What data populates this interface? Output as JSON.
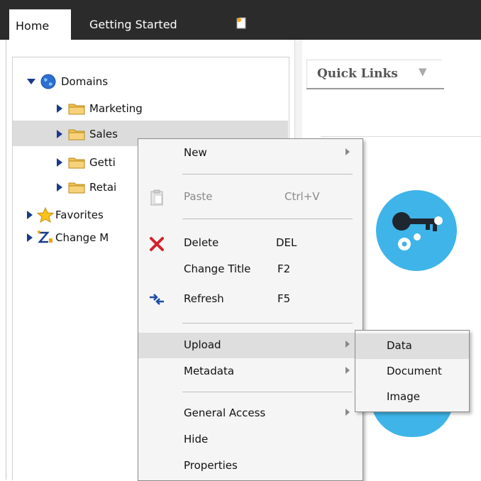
{
  "tabs": {
    "home": "Home",
    "getting_started": "Getting Started"
  },
  "quick_links": {
    "label": "Quick Links"
  },
  "tree": {
    "root": "Domains",
    "children": [
      "Marketing",
      "Sales",
      "Getti",
      "Retai"
    ],
    "favorites": "Favorites",
    "change": "Change M"
  },
  "context_menu": {
    "new": "New",
    "paste": "Paste",
    "paste_shortcut": "Ctrl+V",
    "delete": "Delete",
    "delete_shortcut": "DEL",
    "change_title": "Change Title",
    "change_title_shortcut": "F2",
    "refresh": "Refresh",
    "refresh_shortcut": "F5",
    "upload": "Upload",
    "metadata": "Metadata",
    "general_access": "General Access",
    "hide": "Hide",
    "properties": "Properties"
  },
  "submenu": {
    "data": "Data",
    "document": "Document",
    "image": "Image"
  },
  "colors": {
    "topbar": "#2b2b2b",
    "accent_circle": "#3fb4e8",
    "selection": "#dcdcdc"
  }
}
